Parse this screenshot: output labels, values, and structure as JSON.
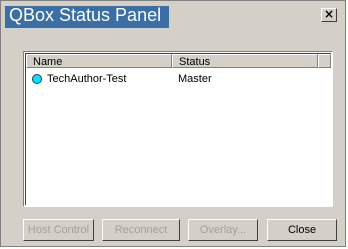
{
  "window": {
    "title": "QBox Status Panel",
    "close_glyph": "×",
    "close_icon": "close-icon"
  },
  "list": {
    "columns": [
      "Name",
      "Status"
    ],
    "rows": [
      {
        "icon": "status-dot-icon",
        "icon_color": "#00e5ff",
        "name": "TechAuthor-Test",
        "status": "Master"
      }
    ]
  },
  "buttons": {
    "host_control": "Host Control",
    "reconnect": "Reconnect",
    "overlay": "Overlay...",
    "close": "Close"
  },
  "colors": {
    "title_bar": "#3a6ea5",
    "dialog_bg": "#d4d0c8",
    "disabled_text": "#a0a0a0"
  }
}
